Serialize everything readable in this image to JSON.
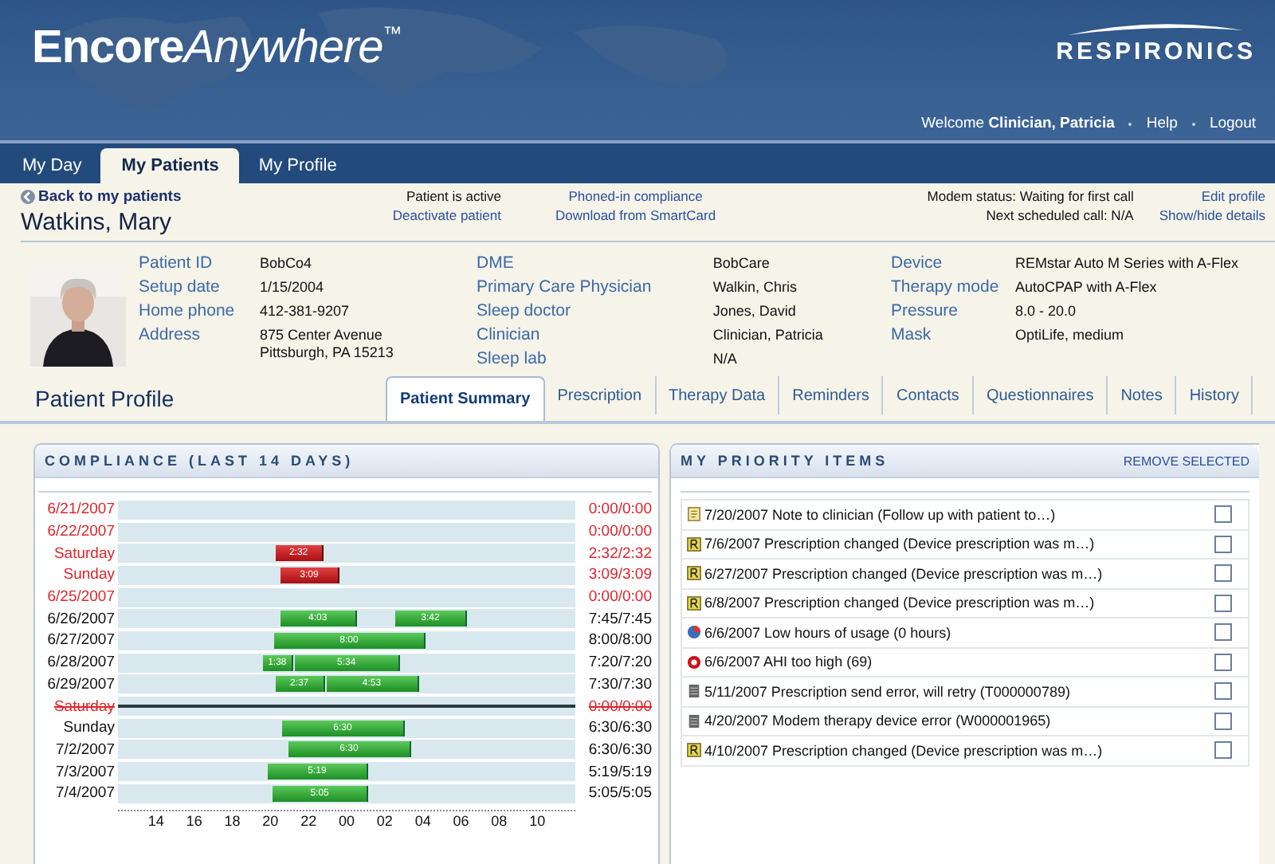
{
  "header": {
    "logo": {
      "bold": "Encore",
      "italic": "Anywhere",
      "mark": "™"
    },
    "company": "RESPIRONICS",
    "welcome": "Welcome **Clinician, Patricia**",
    "links": [
      "Help",
      "Logout"
    ]
  },
  "main_tabs": [
    {
      "label": "My Day",
      "selected": false
    },
    {
      "label": "My Patients",
      "selected": true
    },
    {
      "label": "My Profile",
      "selected": false
    }
  ],
  "patient_bar": {
    "back": "Back to my patients",
    "name": "Watkins, Mary",
    "status": "Patient is active",
    "deactivate": "Deactivate patient",
    "phoned": "Phoned-in compliance",
    "download": "Download from SmartCard",
    "modem": "Modem status: Waiting for first call",
    "next_call": "Next scheduled call: N/A",
    "edit": "Edit profile",
    "toggle": "Show/hide details"
  },
  "details": [
    [
      {
        "label": "Patient ID",
        "value": "BobCo4"
      },
      {
        "label": "Setup date",
        "value": "1/15/2004"
      },
      {
        "label": "Home phone",
        "value": "412-381-9207"
      },
      {
        "label": "Address",
        "value": "875 Center Avenue\nPittsburgh, PA 15213"
      }
    ],
    [
      {
        "label": "DME",
        "value": "BobCare"
      },
      {
        "label": "Primary Care Physician",
        "value": "Walkin, Chris"
      },
      {
        "label": "Sleep doctor",
        "value": "Jones, David"
      },
      {
        "label": "Clinician",
        "value": "Clinician, Patricia"
      },
      {
        "label": "Sleep lab",
        "value": "N/A"
      }
    ],
    [
      {
        "label": "Device",
        "value": "REMstar Auto M Series with A-Flex"
      },
      {
        "label": "Therapy mode",
        "value": "AutoCPAP with A-Flex"
      },
      {
        "label": "Pressure",
        "value": "8.0 - 20.0"
      },
      {
        "label": "Mask",
        "value": "OptiLife, medium"
      }
    ]
  ],
  "profile_title": "Patient Profile",
  "profile_tabs": [
    {
      "label": "Patient Summary",
      "selected": true
    },
    {
      "label": "Prescription",
      "selected": false
    },
    {
      "label": "Therapy Data",
      "selected": false
    },
    {
      "label": "Reminders",
      "selected": false
    },
    {
      "label": "Contacts",
      "selected": false
    },
    {
      "label": "Questionnaires",
      "selected": false
    },
    {
      "label": "Notes",
      "selected": false
    },
    {
      "label": "History",
      "selected": false
    }
  ],
  "compliance": {
    "title": "COMPLIANCE (LAST 14 DAYS)",
    "axis": [
      "14",
      "16",
      "18",
      "20",
      "22",
      "00",
      "02",
      "04",
      "06",
      "08",
      "10"
    ],
    "rows": [
      {
        "day": "6/21/2007",
        "total": "0:00/0:00",
        "alert": true,
        "struck": false,
        "bars": []
      },
      {
        "day": "6/22/2007",
        "total": "0:00/0:00",
        "alert": true,
        "struck": false,
        "bars": []
      },
      {
        "day": "Saturday",
        "total": "2:32/2:32",
        "alert": true,
        "struck": false,
        "bars": [
          "2:32"
        ]
      },
      {
        "day": "Sunday",
        "total": "3:09/3:09",
        "alert": true,
        "struck": false,
        "bars": [
          "3:09"
        ]
      },
      {
        "day": "6/25/2007",
        "total": "0:00/0:00",
        "alert": true,
        "struck": false,
        "bars": []
      },
      {
        "day": "6/26/2007",
        "total": "7:45/7:45",
        "alert": false,
        "struck": false,
        "bars": [
          "4:03",
          "3:42"
        ]
      },
      {
        "day": "6/27/2007",
        "total": "8:00/8:00",
        "alert": false,
        "struck": false,
        "bars": [
          "8:00"
        ]
      },
      {
        "day": "6/28/2007",
        "total": "7:20/7:20",
        "alert": false,
        "struck": false,
        "bars": [
          "1:38",
          "5:34"
        ]
      },
      {
        "day": "6/29/2007",
        "total": "7:30/7:30",
        "alert": false,
        "struck": false,
        "bars": [
          "2:37",
          "4:53"
        ]
      },
      {
        "day": "Saturday",
        "total": "0:00/0:00",
        "alert": true,
        "struck": true,
        "bars": []
      },
      {
        "day": "Sunday",
        "total": "6:30/6:30",
        "alert": false,
        "struck": false,
        "bars": [
          "6:30"
        ]
      },
      {
        "day": "7/2/2007",
        "total": "6:30/6:30",
        "alert": false,
        "struck": false,
        "bars": [
          "6:30"
        ]
      },
      {
        "day": "7/3/2007",
        "total": "5:19/5:19",
        "alert": false,
        "struck": false,
        "bars": [
          "5:19"
        ]
      },
      {
        "day": "7/4/2007",
        "total": "5:05/5:05",
        "alert": false,
        "struck": false,
        "bars": [
          "5:05"
        ]
      }
    ]
  },
  "priority": {
    "title": "MY PRIORITY ITEMS",
    "remove": "REMOVE SELECTED",
    "items": [
      {
        "kind": "note",
        "text": "7/20/2007 Note to clinician (Follow up with patient to…)",
        "checked": false
      },
      {
        "kind": "prescription",
        "text": "7/6/2007 Prescription changed (Device prescription was m…)",
        "checked": false
      },
      {
        "kind": "prescription",
        "text": "6/27/2007 Prescription changed (Device prescription was m…)",
        "checked": false
      },
      {
        "kind": "prescription",
        "text": "6/8/2007 Prescription changed (Device prescription was m…)",
        "checked": false
      },
      {
        "kind": "usage",
        "text": "6/6/2007 Low hours of usage (0 hours)",
        "checked": false
      },
      {
        "kind": "alert",
        "text": "6/6/2007 AHI too high (69)",
        "checked": false
      },
      {
        "kind": "device",
        "text": "5/11/2007 Prescription send error, will retry (T000000789)",
        "checked": false
      },
      {
        "kind": "device",
        "text": "4/20/2007 Modem therapy device error (W000001965)",
        "checked": false
      },
      {
        "kind": "prescription",
        "text": "4/10/2007 Prescription changed (Device prescription was m…)",
        "checked": false
      }
    ]
  }
}
